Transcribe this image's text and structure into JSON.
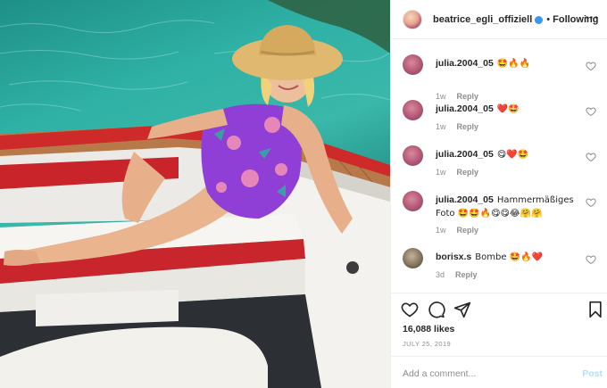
{
  "header": {
    "username": "beatrice_egli_offiziell",
    "separator": "•",
    "follow_label": "Following",
    "more_label": "···"
  },
  "comments": [
    {
      "user": "julia.2004_05",
      "text": "🤩🔥🔥",
      "time": "1w",
      "reply": "Reply"
    },
    {
      "user": "julia.2004_05",
      "text": "❤️🤩",
      "time": "1w",
      "reply": "Reply"
    },
    {
      "user": "julia.2004_05",
      "text": "😋❤️🤩",
      "time": "1w",
      "reply": "Reply"
    },
    {
      "user": "julia.2004_05",
      "text": "Hammermäßiges Foto 🤩🤩🔥😋😋😂🤗🤗",
      "time": "1w",
      "reply": "Reply"
    },
    {
      "user": "borisx.s",
      "text": "Bombe 🤩🔥❤️",
      "time": "3d",
      "reply": "Reply"
    }
  ],
  "stats": {
    "likes": "16,088 likes",
    "date": "JULY 25, 2019"
  },
  "add_comment": {
    "placeholder": "Add a comment...",
    "post_label": "Post"
  },
  "colors": {
    "link_blue": "#3897f0",
    "post_disabled": "#b2dffc",
    "meta_gray": "#8e8e8e"
  }
}
